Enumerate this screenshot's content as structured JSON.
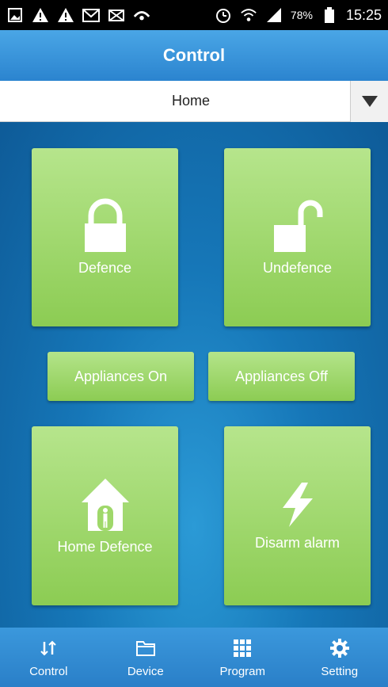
{
  "status_bar": {
    "battery_percent": "78%",
    "time": "15:25",
    "left_icons": [
      "image-icon",
      "warning-icon",
      "warning-icon",
      "gmail-icon",
      "mail-icon",
      "voicemail-icon"
    ],
    "right_icons": [
      "alarm-icon",
      "wifi-icon",
      "signal-icon",
      "battery-icon"
    ]
  },
  "header": {
    "title": "Control"
  },
  "selector": {
    "value": "Home"
  },
  "tiles": {
    "defence": "Defence",
    "undefence": "Undefence",
    "appliances_on": "Appliances On",
    "appliances_off": "Appliances Off",
    "home_defence": "Home Defence",
    "disarm_alarm": "Disarm alarm"
  },
  "tabs": [
    {
      "label": "Control",
      "icon": "arrows-icon"
    },
    {
      "label": "Device",
      "icon": "folder-icon"
    },
    {
      "label": "Program",
      "icon": "grid-icon"
    },
    {
      "label": "Setting",
      "icon": "gear-icon"
    }
  ],
  "colors": {
    "accent": "#2b84cf",
    "tile": "#9fd86a",
    "background": "#1677b8"
  }
}
